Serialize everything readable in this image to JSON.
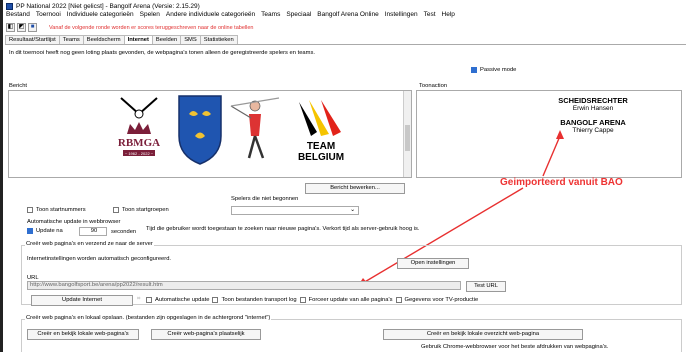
{
  "title": "PP National 2022 [Niet gelicst] - Bangolf Arena (Versie: 2.15.29)",
  "menu": [
    "Bestand",
    "Toernooi",
    "Individuele categorieën",
    "Spelen",
    "Andere individuele categorieën",
    "Teams",
    "Speciaal",
    "Bangolf Arena Online",
    "Instellingen",
    "Test",
    "Help"
  ],
  "toolbar": {
    "warning": "Vanaf de volgende ronde worden er scores teruggeschreven naar de online tabellen"
  },
  "tabs": [
    "Resultaat/Startlijst",
    "Teams",
    "Beeldscherm",
    "Internet",
    "Beelden",
    "SMS",
    "Statistieken"
  ],
  "active_tab": "Internet",
  "hint": "In dit toernooi heeft nog geen loting plaats gevonden, de webpagina's tonen alleen de geregistreerde spelers en teams.",
  "passive_mode": "Passive mode",
  "bericht_label": "Bericht",
  "toonaction_label": "Toonaction",
  "logos": {
    "rbmga": "RBMGA",
    "rbmga_sub": "~ 1962 - 2022 ~",
    "team": "TEAM",
    "belgium": "BELGIUM"
  },
  "referee": {
    "h1": "SCHEIDSRECHTER",
    "n1": "Erwin Hansen",
    "h2": "BANGOLF ARENA",
    "n2": "Thierry Cappe"
  },
  "edit_message_button": "Bericht bewerken...",
  "players_not_started": "Spelers die niet begonnen",
  "show_start_numbers": "Toon startnummers",
  "show_start_groups": "Toon startgroepen",
  "auto_update": {
    "label": "Automatische update in webbrowser",
    "update_every": "Update na",
    "value": "90",
    "unit": "seconden",
    "note": "Tijd die gebruiker wordt toegestaan te zoeken naar nieuwe pagina's. Verkort tijd als server-gebruik hoog is."
  },
  "server_section": "Creër web pagina's en verzend ze naar de server",
  "auto_config": "Internetinstellingen worden automatisch geconfigureerd.",
  "open_settings": "Open instellingen",
  "url_label": "URL",
  "url_value": "http://www.bangolfsport.be/arena/pp2022/result.htm",
  "test_url": "Test URL",
  "update_internet": "Update Internet",
  "options": [
    "Automatische update",
    "Toon bestanden transport log",
    "Forceer update van alle pagina's",
    "Gegevens voor TV-productie"
  ],
  "local_section": "Creër web pagina's en lokaal opslaan. (bestanden zijn opgeslagen in de achtergrond \"internet\")",
  "local_buttons": [
    "Creër en bekijk lokale web-pagina's",
    "Creër web-pagina's plaatselijk",
    "Creër en bekijk lokale overzicht web-pagina"
  ],
  "chrome_note": "Gebruik Chrome-webbrowser voor het beste afdrukken van webpagina's.",
  "annotation": "Geimporteerd vanuit BAO",
  "colors": {
    "accent": "#2f6fd0",
    "annotation": "#e83030"
  }
}
